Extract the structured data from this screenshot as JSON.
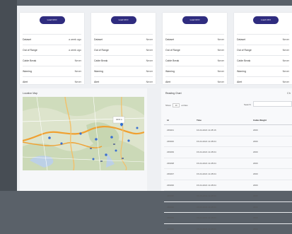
{
  "cards": [
    {
      "button": "Load UFO",
      "rows": [
        {
          "label": "Dataset",
          "value": "a week ago"
        },
        {
          "label": "Out of Range",
          "value": "a week ago"
        },
        {
          "label": "Cable Break",
          "value": "Never"
        },
        {
          "label": "Warning",
          "value": "Never"
        },
        {
          "label": "Alert",
          "value": "Never"
        }
      ]
    },
    {
      "button": "Load UFO",
      "rows": [
        {
          "label": "Dataset",
          "value": "Never"
        },
        {
          "label": "Out of Range",
          "value": "Never"
        },
        {
          "label": "Cable Break",
          "value": "Never"
        },
        {
          "label": "Warning",
          "value": "Never"
        },
        {
          "label": "Alert",
          "value": "Never"
        }
      ]
    },
    {
      "button": "Load UFO",
      "rows": [
        {
          "label": "Dataset",
          "value": "Never"
        },
        {
          "label": "Out of Range",
          "value": "Never"
        },
        {
          "label": "Cable Break",
          "value": "Never"
        },
        {
          "label": "Warning",
          "value": "Never"
        },
        {
          "label": "Alert",
          "value": "Never"
        }
      ]
    },
    {
      "button": "Load UFO",
      "rows": [
        {
          "label": "Dataset",
          "value": "Never"
        },
        {
          "label": "Out of Range",
          "value": "Never"
        },
        {
          "label": "Cable Break",
          "value": "Never"
        },
        {
          "label": "Warning",
          "value": "Never"
        },
        {
          "label": "Alert",
          "value": "Never"
        }
      ]
    }
  ],
  "map": {
    "title": "Location Map",
    "popup": "UFO 1"
  },
  "readings": {
    "title": "Reading Chart",
    "badge": "Ch",
    "show_label": "Show",
    "entries_value": "10",
    "entries_label": "entries",
    "search_label": "Search:",
    "columns": [
      "Id",
      "Time",
      "Cable Weight"
    ],
    "rows": [
      [
        "239041",
        "16-04-2021 11:28:16",
        "2000"
      ],
      [
        "239040",
        "15-04-2021 11:28:04",
        "2000"
      ],
      [
        "239039",
        "15-04-2021 11:28:04",
        "2000"
      ],
      [
        "239038",
        "15-04-2021 11:28:04",
        "2000"
      ],
      [
        "239037",
        "15-04-2021 11:28:04",
        "2000"
      ],
      [
        "239036",
        "15-04-2021 11:28:04",
        "2000"
      ],
      [
        "239035",
        "15-04-2021 11:28:04",
        "2000"
      ],
      [
        "239034",
        "15-04-2021 11:28:04",
        "2000"
      ],
      [
        "239033",
        "15-04-2021 11:28:04",
        "2000"
      ],
      [
        "239032",
        "15-04-2021 11:28:04",
        "2000"
      ]
    ]
  }
}
